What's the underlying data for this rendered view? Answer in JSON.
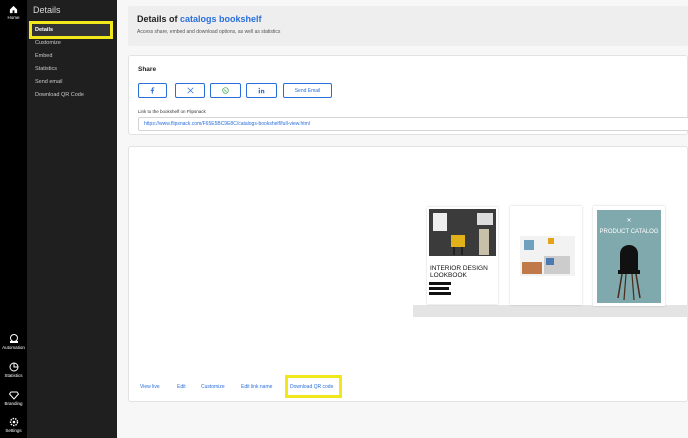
{
  "rail": {
    "home": "Home",
    "automation": "Automation",
    "statistics": "Statistics",
    "branding": "Branding",
    "settings": "Settings"
  },
  "subnav": {
    "title": "Details",
    "items": [
      "Details",
      "Customize",
      "Embed",
      "Statistics",
      "Send email",
      "Download QR Code"
    ]
  },
  "header": {
    "title_prefix": "Details of ",
    "title_name": "catalogs bookshelf",
    "subtitle": "Access share, embed and download options, as well as statistics"
  },
  "share": {
    "title": "Share",
    "send_email": "Send Email",
    "link_label": "Link to the bookshelf on Flipsnack",
    "link_value": "https://www.flipsnack.com/F65E5BC9E8C/catalogs-bookshelf/full-view.html"
  },
  "books": {
    "lookbook_title": "INTERIOR DESIGN LOOKBOOK",
    "catalog_title": "PRODUCT CATALOG"
  },
  "actions": [
    "View live",
    "Edit",
    "Customize",
    "Edit link name",
    "Download QR code"
  ],
  "colors": {
    "accent": "#2a6fdb",
    "highlight": "#f0e81a",
    "catalog_cover": "#7fa9ad"
  }
}
